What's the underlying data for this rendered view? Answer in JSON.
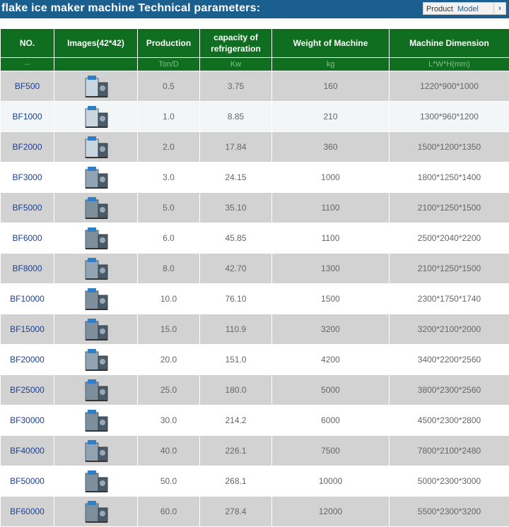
{
  "header": {
    "title": "flake ice maker machine Technical parameters:",
    "tab_product": "Product",
    "tab_model": "Model",
    "tab_arrow": "›"
  },
  "table": {
    "columns": [
      "NO.",
      "Images(42*42)",
      "Production",
      "capacity of refrigeration",
      "Weight of Machine",
      "Machine Dimension"
    ],
    "units": [
      "--",
      "",
      "Ton/D",
      "Kw",
      "kg",
      "L*W*H(mm)"
    ],
    "rows": [
      {
        "no": "BF500",
        "production": "0.5",
        "capacity": "3.75",
        "weight": "160",
        "dimension": "1220*900*1000"
      },
      {
        "no": "BF1000",
        "production": "1.0",
        "capacity": "8.85",
        "weight": "210",
        "dimension": "1300*960*1200"
      },
      {
        "no": "BF2000",
        "production": "2.0",
        "capacity": "17.84",
        "weight": "360",
        "dimension": "1500*1200*1350"
      },
      {
        "no": "BF3000",
        "production": "3.0",
        "capacity": "24.15",
        "weight": "1000",
        "dimension": "1800*1250*1400"
      },
      {
        "no": "BF5000",
        "production": "5.0",
        "capacity": "35.10",
        "weight": "1100",
        "dimension": "2100*1250*1500"
      },
      {
        "no": "BF6000",
        "production": "6.0",
        "capacity": "45.85",
        "weight": "1100",
        "dimension": "2500*2040*2200"
      },
      {
        "no": "BF8000",
        "production": "8.0",
        "capacity": "42.70",
        "weight": "1300",
        "dimension": "2100*1250*1500"
      },
      {
        "no": "BF10000",
        "production": "10.0",
        "capacity": "76.10",
        "weight": "1500",
        "dimension": "2300*1750*1740"
      },
      {
        "no": "BF15000",
        "production": "15.0",
        "capacity": "110.9",
        "weight": "3200",
        "dimension": "3200*2100*2000"
      },
      {
        "no": "BF20000",
        "production": "20.0",
        "capacity": "151.0",
        "weight": "4200",
        "dimension": "3400*2200*2560"
      },
      {
        "no": "BF25000",
        "production": "25.0",
        "capacity": "180.0",
        "weight": "5000",
        "dimension": "3800*2300*2560"
      },
      {
        "no": "BF30000",
        "production": "30.0",
        "capacity": "214.2",
        "weight": "6000",
        "dimension": "4500*2300*2800"
      },
      {
        "no": "BF40000",
        "production": "40.0",
        "capacity": "226.1",
        "weight": "7500",
        "dimension": "7800*2100*2480"
      },
      {
        "no": "BF50000",
        "production": "50.0",
        "capacity": "268.1",
        "weight": "10000",
        "dimension": "5000*2300*3000"
      },
      {
        "no": "BF60000",
        "production": "60.0",
        "capacity": "278.4",
        "weight": "12000",
        "dimension": "5500*2300*3200"
      }
    ]
  },
  "colors": {
    "topbar": "#1a5f8e",
    "header_green": "#0f6e1f",
    "row_gray": "#d2d2d2",
    "model_link": "#1a3f99"
  }
}
